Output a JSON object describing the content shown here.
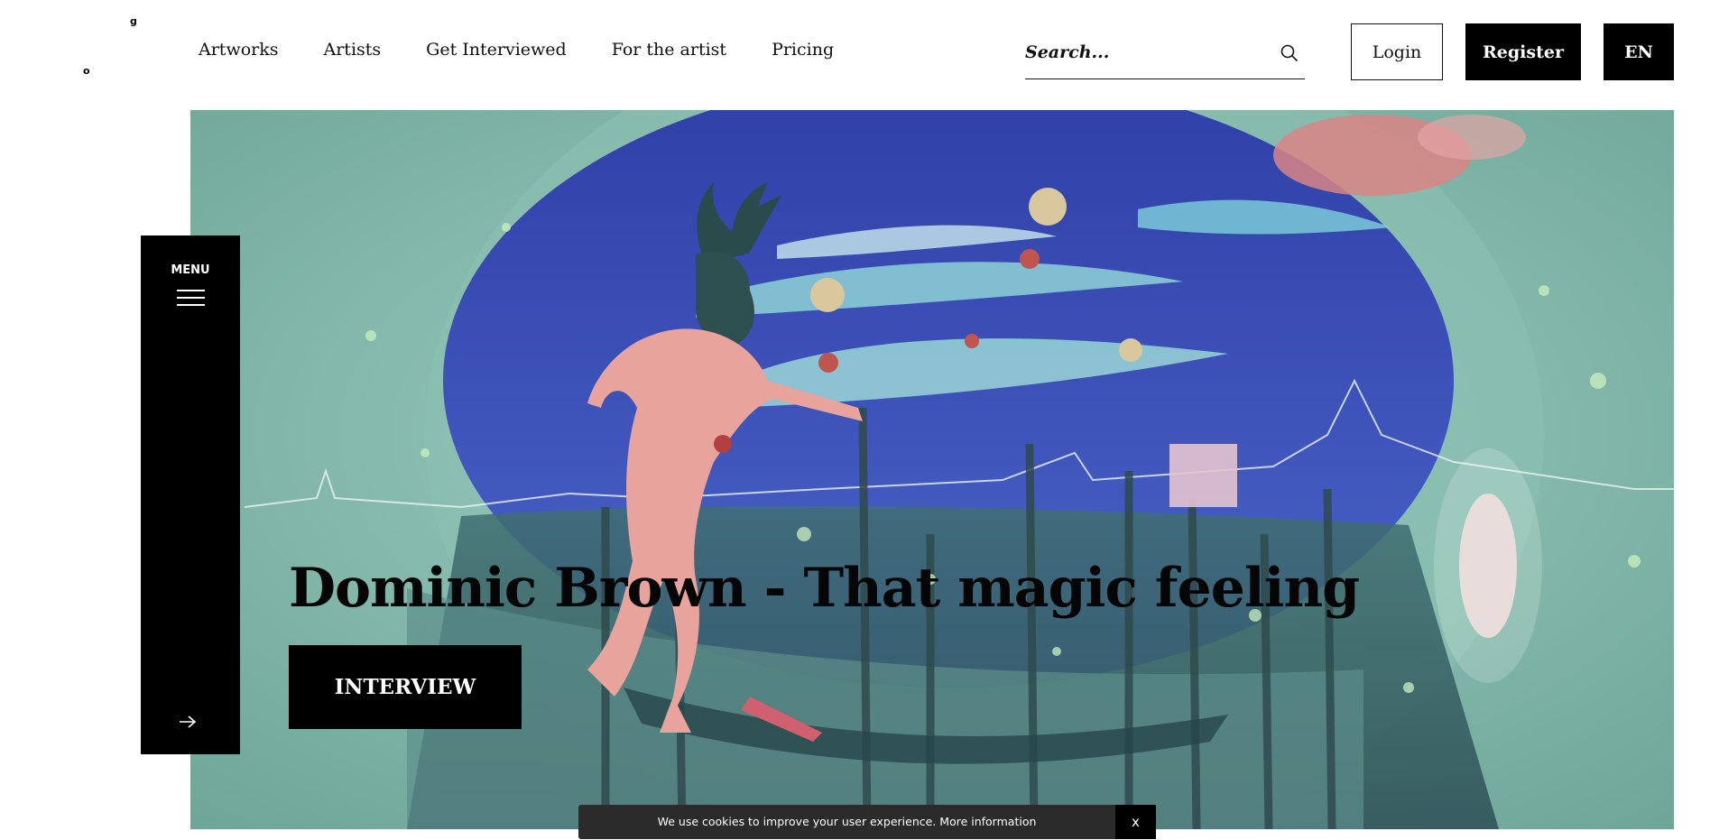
{
  "logo": {
    "frag_top": "g",
    "frag_bottom": "o"
  },
  "nav": {
    "items": [
      "Artworks",
      "Artists",
      "Get Interviewed",
      "For the artist",
      "Pricing"
    ]
  },
  "search": {
    "placeholder": "Search...",
    "icon": "search-icon"
  },
  "header_buttons": {
    "login": "Login",
    "register": "Register",
    "language": "EN"
  },
  "menu": {
    "label": "MENU",
    "icons": [
      "hamburger-icon",
      "arrow-right-icon"
    ]
  },
  "hero": {
    "title": "Dominic Brown - That magic feeling",
    "cta": "INTERVIEW"
  },
  "cookie": {
    "message": "We use cookies to improve your user experience. More information",
    "close": "x"
  }
}
